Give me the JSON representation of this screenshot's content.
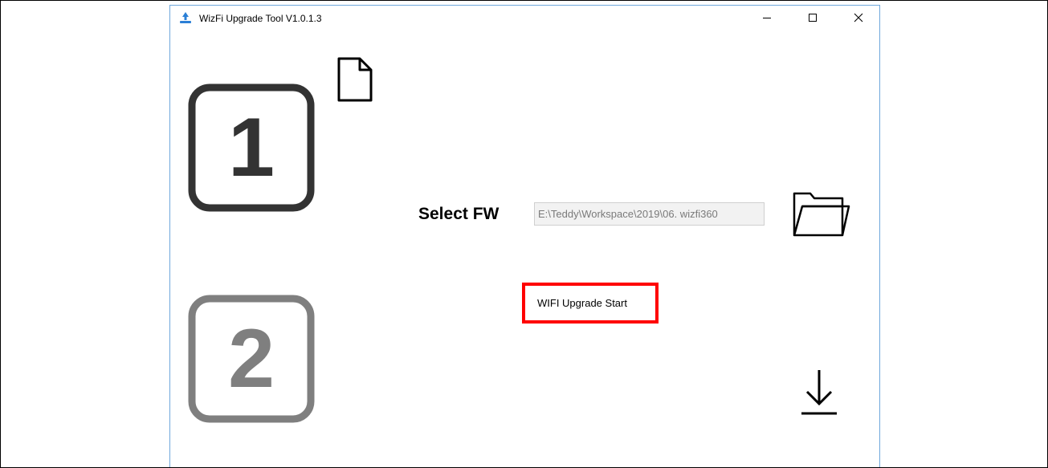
{
  "window": {
    "title": "WizFi Upgrade Tool V1.0.1.3",
    "app_icon": "blue-upload-arrow-icon",
    "controls": {
      "minimize_icon": "minimize-icon",
      "maximize_icon": "maximize-icon",
      "close_icon": "close-icon"
    }
  },
  "steps": [
    {
      "number": "1",
      "color": "#333333"
    },
    {
      "number": "2",
      "color": "#7f7f7f"
    }
  ],
  "firmware": {
    "file_icon": "file-icon",
    "select_label": "Select FW",
    "path_value": "E:\\Teddy\\Workspace\\2019\\06. wizfi360",
    "browse_icon": "folder-icon"
  },
  "upgrade": {
    "start_label": "WIFI Upgrade Start",
    "highlight_color": "#ff0000",
    "download_icon": "download-arrow-icon"
  },
  "colors": {
    "window_border": "#6fa8dc",
    "app_icon_blue": "#2b7fd6"
  }
}
